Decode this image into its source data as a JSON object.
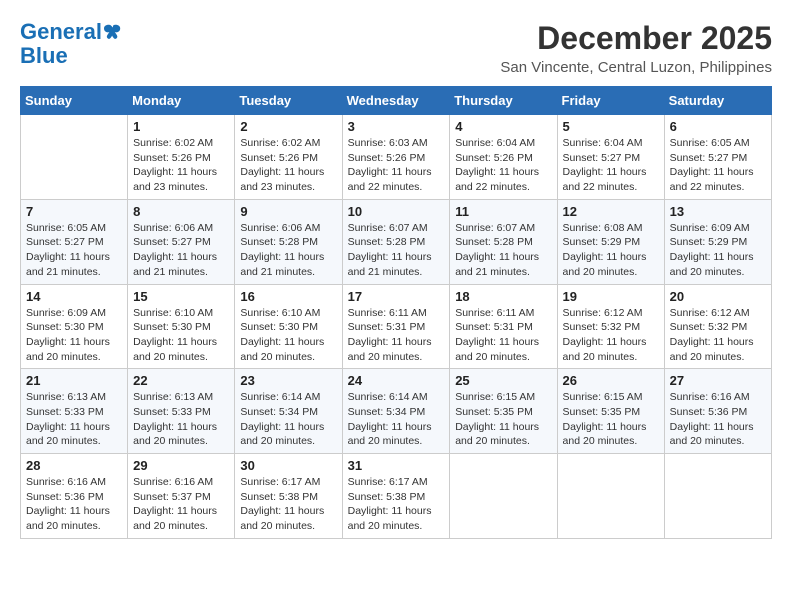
{
  "logo": {
    "line1": "General",
    "line2": "Blue"
  },
  "title": "December 2025",
  "location": "San Vincente, Central Luzon, Philippines",
  "weekdays": [
    "Sunday",
    "Monday",
    "Tuesday",
    "Wednesday",
    "Thursday",
    "Friday",
    "Saturday"
  ],
  "weeks": [
    [
      {
        "day": "",
        "info": ""
      },
      {
        "day": "1",
        "info": "Sunrise: 6:02 AM\nSunset: 5:26 PM\nDaylight: 11 hours\nand 23 minutes."
      },
      {
        "day": "2",
        "info": "Sunrise: 6:02 AM\nSunset: 5:26 PM\nDaylight: 11 hours\nand 23 minutes."
      },
      {
        "day": "3",
        "info": "Sunrise: 6:03 AM\nSunset: 5:26 PM\nDaylight: 11 hours\nand 22 minutes."
      },
      {
        "day": "4",
        "info": "Sunrise: 6:04 AM\nSunset: 5:26 PM\nDaylight: 11 hours\nand 22 minutes."
      },
      {
        "day": "5",
        "info": "Sunrise: 6:04 AM\nSunset: 5:27 PM\nDaylight: 11 hours\nand 22 minutes."
      },
      {
        "day": "6",
        "info": "Sunrise: 6:05 AM\nSunset: 5:27 PM\nDaylight: 11 hours\nand 22 minutes."
      }
    ],
    [
      {
        "day": "7",
        "info": "Sunrise: 6:05 AM\nSunset: 5:27 PM\nDaylight: 11 hours\nand 21 minutes."
      },
      {
        "day": "8",
        "info": "Sunrise: 6:06 AM\nSunset: 5:27 PM\nDaylight: 11 hours\nand 21 minutes."
      },
      {
        "day": "9",
        "info": "Sunrise: 6:06 AM\nSunset: 5:28 PM\nDaylight: 11 hours\nand 21 minutes."
      },
      {
        "day": "10",
        "info": "Sunrise: 6:07 AM\nSunset: 5:28 PM\nDaylight: 11 hours\nand 21 minutes."
      },
      {
        "day": "11",
        "info": "Sunrise: 6:07 AM\nSunset: 5:28 PM\nDaylight: 11 hours\nand 21 minutes."
      },
      {
        "day": "12",
        "info": "Sunrise: 6:08 AM\nSunset: 5:29 PM\nDaylight: 11 hours\nand 20 minutes."
      },
      {
        "day": "13",
        "info": "Sunrise: 6:09 AM\nSunset: 5:29 PM\nDaylight: 11 hours\nand 20 minutes."
      }
    ],
    [
      {
        "day": "14",
        "info": "Sunrise: 6:09 AM\nSunset: 5:30 PM\nDaylight: 11 hours\nand 20 minutes."
      },
      {
        "day": "15",
        "info": "Sunrise: 6:10 AM\nSunset: 5:30 PM\nDaylight: 11 hours\nand 20 minutes."
      },
      {
        "day": "16",
        "info": "Sunrise: 6:10 AM\nSunset: 5:30 PM\nDaylight: 11 hours\nand 20 minutes."
      },
      {
        "day": "17",
        "info": "Sunrise: 6:11 AM\nSunset: 5:31 PM\nDaylight: 11 hours\nand 20 minutes."
      },
      {
        "day": "18",
        "info": "Sunrise: 6:11 AM\nSunset: 5:31 PM\nDaylight: 11 hours\nand 20 minutes."
      },
      {
        "day": "19",
        "info": "Sunrise: 6:12 AM\nSunset: 5:32 PM\nDaylight: 11 hours\nand 20 minutes."
      },
      {
        "day": "20",
        "info": "Sunrise: 6:12 AM\nSunset: 5:32 PM\nDaylight: 11 hours\nand 20 minutes."
      }
    ],
    [
      {
        "day": "21",
        "info": "Sunrise: 6:13 AM\nSunset: 5:33 PM\nDaylight: 11 hours\nand 20 minutes."
      },
      {
        "day": "22",
        "info": "Sunrise: 6:13 AM\nSunset: 5:33 PM\nDaylight: 11 hours\nand 20 minutes."
      },
      {
        "day": "23",
        "info": "Sunrise: 6:14 AM\nSunset: 5:34 PM\nDaylight: 11 hours\nand 20 minutes."
      },
      {
        "day": "24",
        "info": "Sunrise: 6:14 AM\nSunset: 5:34 PM\nDaylight: 11 hours\nand 20 minutes."
      },
      {
        "day": "25",
        "info": "Sunrise: 6:15 AM\nSunset: 5:35 PM\nDaylight: 11 hours\nand 20 minutes."
      },
      {
        "day": "26",
        "info": "Sunrise: 6:15 AM\nSunset: 5:35 PM\nDaylight: 11 hours\nand 20 minutes."
      },
      {
        "day": "27",
        "info": "Sunrise: 6:16 AM\nSunset: 5:36 PM\nDaylight: 11 hours\nand 20 minutes."
      }
    ],
    [
      {
        "day": "28",
        "info": "Sunrise: 6:16 AM\nSunset: 5:36 PM\nDaylight: 11 hours\nand 20 minutes."
      },
      {
        "day": "29",
        "info": "Sunrise: 6:16 AM\nSunset: 5:37 PM\nDaylight: 11 hours\nand 20 minutes."
      },
      {
        "day": "30",
        "info": "Sunrise: 6:17 AM\nSunset: 5:38 PM\nDaylight: 11 hours\nand 20 minutes."
      },
      {
        "day": "31",
        "info": "Sunrise: 6:17 AM\nSunset: 5:38 PM\nDaylight: 11 hours\nand 20 minutes."
      },
      {
        "day": "",
        "info": ""
      },
      {
        "day": "",
        "info": ""
      },
      {
        "day": "",
        "info": ""
      }
    ]
  ]
}
